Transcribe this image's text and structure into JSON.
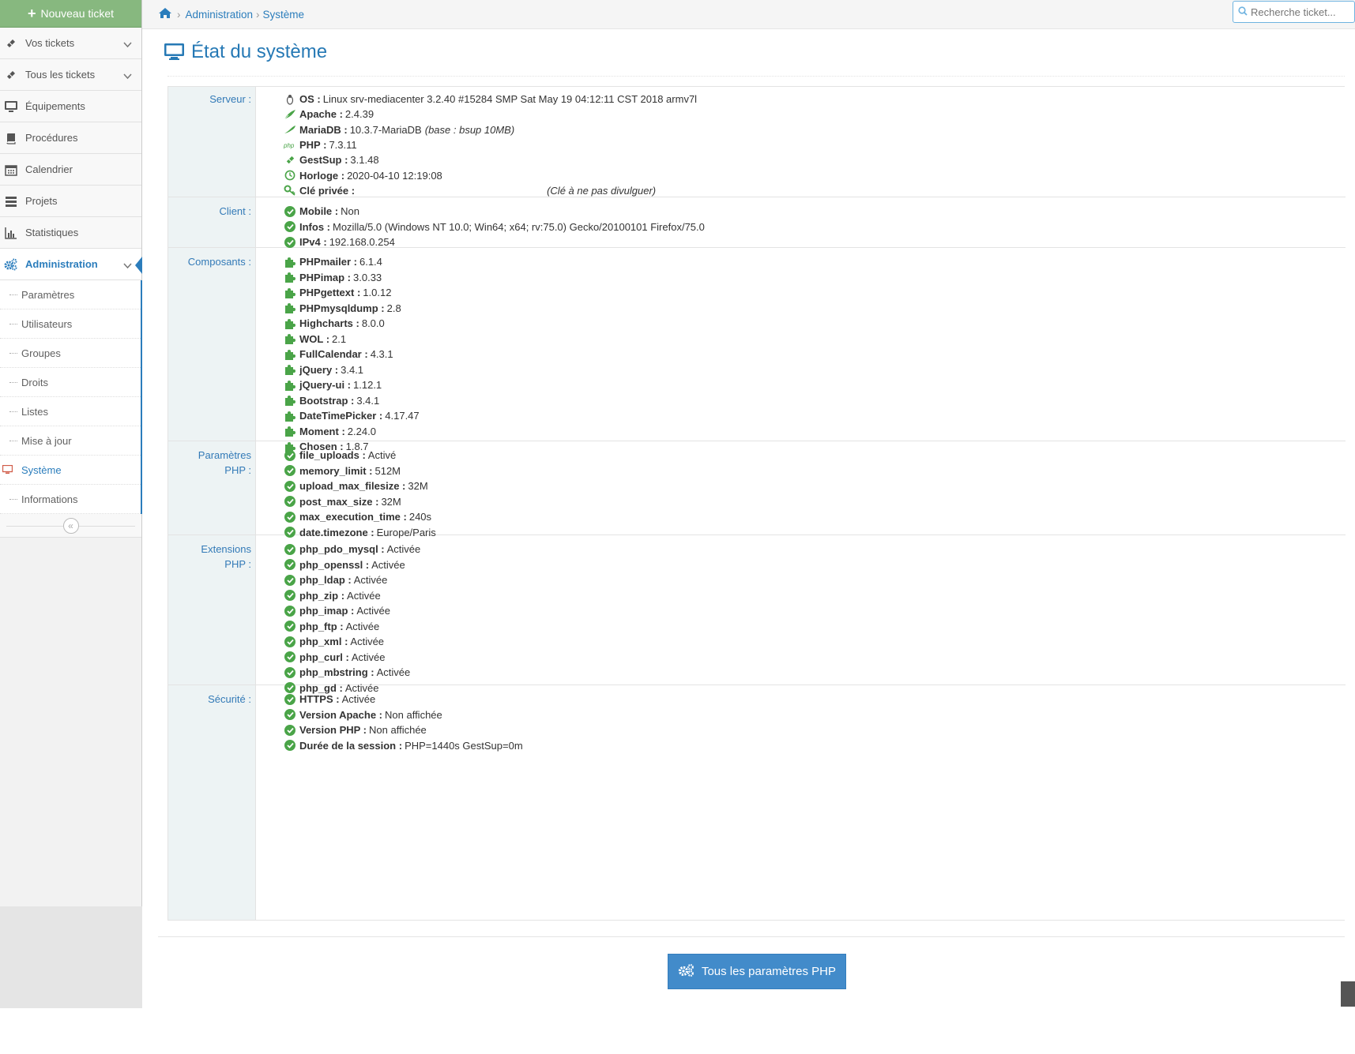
{
  "sidebar": {
    "new_ticket": "Nouveau ticket",
    "items": [
      {
        "label": "Vos tickets",
        "icon": "ticket-icon"
      },
      {
        "label": "Tous les tickets",
        "icon": "ticket-icon"
      },
      {
        "label": "Équipements",
        "icon": "desktop-icon"
      },
      {
        "label": "Procédures",
        "icon": "book-icon"
      },
      {
        "label": "Calendrier",
        "icon": "calendar-icon"
      },
      {
        "label": "Projets",
        "icon": "tasks-icon"
      },
      {
        "label": "Statistiques",
        "icon": "bar-chart-icon"
      },
      {
        "label": "Administration",
        "icon": "cogs-icon"
      }
    ],
    "sub_items": [
      {
        "label": "Paramètres"
      },
      {
        "label": "Utilisateurs"
      },
      {
        "label": "Groupes"
      },
      {
        "label": "Droits"
      },
      {
        "label": "Listes"
      },
      {
        "label": "Mise à jour"
      },
      {
        "label": "Système"
      },
      {
        "label": "Informations"
      }
    ]
  },
  "breadcrumb": {
    "home_icon": "home-icon",
    "level1": "Administration",
    "level2": "Système"
  },
  "search": {
    "placeholder": "Recherche ticket..."
  },
  "page_title": "État du système",
  "sections": [
    {
      "label": "Serveur :",
      "rows": [
        {
          "key": "OS :",
          "value": "Linux srv-mediacenter 3.2.40 #15284 SMP Sat May 19 04:12:11 CST 2018 armv7l",
          "icon": "linux-icon"
        },
        {
          "key": "Apache :",
          "value": "2.4.39",
          "icon": "feather-icon"
        },
        {
          "key": "MariaDB :",
          "value": "10.3.7-MariaDB",
          "extra": "(base : bsup 10MB)",
          "icon": "seal-icon"
        },
        {
          "key": "PHP :",
          "value": "7.3.11",
          "icon": "php-icon"
        },
        {
          "key": "GestSup :",
          "value": "3.1.48",
          "icon": "ticket-icon"
        },
        {
          "key": "Horloge :",
          "value": "2020-04-10 12:19:08",
          "icon": "clock-icon"
        },
        {
          "key": "Clé privée :",
          "value": "",
          "extra": "(Clé à ne pas divulguer)",
          "icon": "key-icon"
        }
      ]
    },
    {
      "label": "Client :",
      "rows": [
        {
          "key": "Mobile :",
          "value": "Non"
        },
        {
          "key": "Infos :",
          "value": "Mozilla/5.0 (Windows NT 10.0; Win64; x64; rv:75.0) Gecko/20100101 Firefox/75.0"
        },
        {
          "key": "IPv4 :",
          "value": "192.168.0.254"
        }
      ]
    },
    {
      "label": "Composants :",
      "rows": [
        {
          "key": "PHPmailer :",
          "value": "6.1.4"
        },
        {
          "key": "PHPimap :",
          "value": "3.0.33"
        },
        {
          "key": "PHPgettext :",
          "value": "1.0.12"
        },
        {
          "key": "PHPmysqldump :",
          "value": "2.8"
        },
        {
          "key": "Highcharts :",
          "value": "8.0.0"
        },
        {
          "key": "WOL :",
          "value": "2.1"
        },
        {
          "key": "FullCalendar :",
          "value": "4.3.1"
        },
        {
          "key": "jQuery :",
          "value": "3.4.1"
        },
        {
          "key": "jQuery-ui :",
          "value": "1.12.1"
        },
        {
          "key": "Bootstrap :",
          "value": "3.4.1"
        },
        {
          "key": "DateTimePicker :",
          "value": "4.17.47"
        },
        {
          "key": "Moment :",
          "value": "2.24.0"
        },
        {
          "key": "Chosen :",
          "value": "1.8.7"
        }
      ]
    },
    {
      "label_line1": "Paramètres",
      "label_line2": "PHP :",
      "rows": [
        {
          "key": "file_uploads :",
          "value": "Activé"
        },
        {
          "key": "memory_limit :",
          "value": "512M"
        },
        {
          "key": "upload_max_filesize :",
          "value": "32M"
        },
        {
          "key": "post_max_size :",
          "value": "32M"
        },
        {
          "key": "max_execution_time :",
          "value": "240s"
        },
        {
          "key": "date.timezone :",
          "value": "Europe/Paris"
        }
      ]
    },
    {
      "label_line1": "Extensions",
      "label_line2": "PHP :",
      "rows": [
        {
          "key": "php_pdo_mysql :",
          "value": "Activée"
        },
        {
          "key": "php_openssl :",
          "value": "Activée"
        },
        {
          "key": "php_ldap :",
          "value": "Activée"
        },
        {
          "key": "php_zip :",
          "value": "Activée"
        },
        {
          "key": "php_imap :",
          "value": "Activée"
        },
        {
          "key": "php_ftp :",
          "value": "Activée"
        },
        {
          "key": "php_xml :",
          "value": "Activée"
        },
        {
          "key": "php_curl :",
          "value": "Activée"
        },
        {
          "key": "php_mbstring :",
          "value": "Activée"
        },
        {
          "key": "php_gd :",
          "value": "Activée"
        }
      ]
    },
    {
      "label": "Sécurité :",
      "rows": [
        {
          "key": "HTTPS :",
          "value": "Activée"
        },
        {
          "key": "Version Apache :",
          "value": "Non affichée"
        },
        {
          "key": "Version PHP :",
          "value": "Non affichée"
        },
        {
          "key": "Durée de la session :",
          "value": "PHP=1440s GestSup=0m"
        }
      ]
    }
  ],
  "php_button": "Tous les paramètres PHP",
  "colors": {
    "accent": "#2b7dbc",
    "success": "#4aa448",
    "new_ticket_bg": "#87b87f",
    "button_bg": "#428bca",
    "label_col_bg": "#edf3f4"
  }
}
